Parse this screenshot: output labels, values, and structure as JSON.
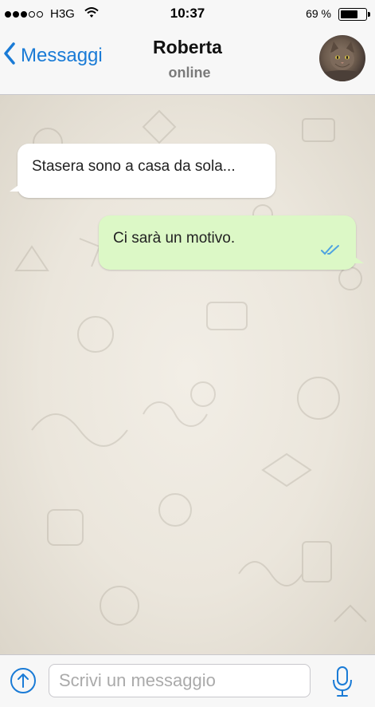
{
  "status_bar": {
    "signal_full": 3,
    "signal_total": 5,
    "carrier": "H3G",
    "time": "10:37",
    "battery_percent": "69 %",
    "battery_level": 0.69
  },
  "header": {
    "back_label": "Messaggi",
    "contact_name": "Roberta",
    "contact_status": "online",
    "avatar_icon": "cat-photo-avatar"
  },
  "messages": [
    {
      "direction": "incoming",
      "text": "Stasera sono a casa da sola..."
    },
    {
      "direction": "outgoing",
      "text": "Ci sarà un motivo.",
      "status": "read",
      "status_icon": "double-check-icon"
    }
  ],
  "input_bar": {
    "placeholder": "Scrivi un messaggio",
    "value": "",
    "attach_icon": "upload-arrow-icon",
    "mic_icon": "microphone-icon"
  },
  "colors": {
    "accent": "#1a7bd6",
    "outgoing_bubble": "#dcf8c6",
    "incoming_bubble": "#ffffff",
    "chat_background": "#ebe6dc",
    "read_check": "#4fa3e0"
  }
}
